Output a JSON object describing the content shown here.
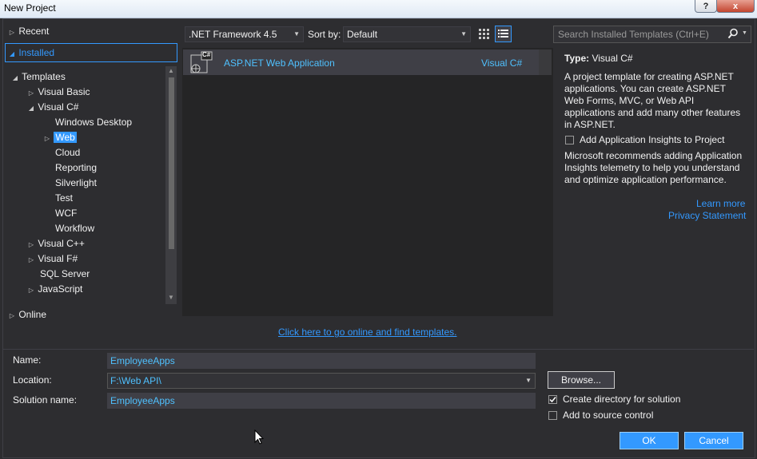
{
  "window": {
    "title": "New Project",
    "help_label": "?",
    "close_label": "x"
  },
  "tree": {
    "recent": "Recent",
    "installed": "Installed",
    "templates": "Templates",
    "visual_basic": "Visual Basic",
    "visual_csharp": "Visual C#",
    "csharp_children": [
      "Windows Desktop",
      "Web",
      "Cloud",
      "Reporting",
      "Silverlight",
      "Test",
      "WCF",
      "Workflow"
    ],
    "visual_cpp": "Visual C++",
    "visual_fsharp": "Visual F#",
    "sql_server": "SQL Server",
    "javascript": "JavaScript",
    "online": "Online"
  },
  "toolbar": {
    "framework": ".NET Framework 4.5",
    "sort_label": "Sort by:",
    "sort_value": "Default",
    "search_placeholder": "Search Installed Templates (Ctrl+E)"
  },
  "template": {
    "name": "ASP.NET Web Application",
    "language": "Visual C#",
    "icon_badge": "C#"
  },
  "online_link": "Click here to go online and find templates.",
  "info": {
    "type_label": "Type:",
    "type_value": "Visual C#",
    "description": "A project template for creating ASP.NET applications. You can create ASP.NET Web Forms, MVC,  or Web API applications and add many other features in ASP.NET.",
    "insights_label": "Add Application Insights to Project",
    "insights_text": "Microsoft recommends adding Application Insights telemetry to help you understand and optimize application performance.",
    "learn_more": "Learn more",
    "privacy": "Privacy Statement"
  },
  "form": {
    "name_label": "Name:",
    "name_value": "EmployeeApps",
    "location_label": "Location:",
    "location_value": "F:\\Web API\\",
    "solution_label": "Solution name:",
    "solution_value": "EmployeeApps",
    "browse": "Browse...",
    "create_dir": "Create directory for solution",
    "create_dir_checked": true,
    "source_control": "Add to source control",
    "source_control_checked": false,
    "ok": "OK",
    "cancel": "Cancel"
  },
  "colors": {
    "accent": "#3399ff",
    "link": "#4fc1ff",
    "background": "#2d2d30",
    "list_bg": "#252526"
  }
}
